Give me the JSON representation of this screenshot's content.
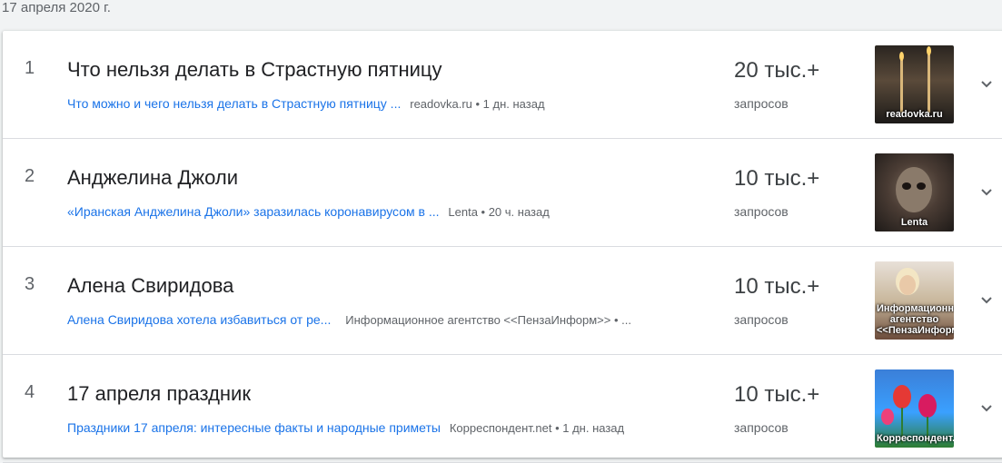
{
  "date_header": "17 апреля 2020 г.",
  "rows": [
    {
      "rank": "1",
      "title": "Что нельзя делать в Страстную пятницу",
      "article_title": "Что можно и чего нельзя делать в Страстную пятницу ...",
      "article_source": "readovka.ru • 1 дн. назад",
      "count": "20 тыс.+",
      "count_label": "запросов",
      "thumb_label": "readovka.ru"
    },
    {
      "rank": "2",
      "title": "Анджелина Джоли",
      "article_title": "«Иранская Анджелина Джоли» заразилась коронавирусом в ...",
      "article_source": "Lenta • 20 ч. назад",
      "count": "10 тыс.+",
      "count_label": "запросов",
      "thumb_label": "Lenta"
    },
    {
      "rank": "3",
      "title": "Алена Свиридова",
      "article_title": "Алена Свиридова хотела избавиться от ре...",
      "article_source": "Информационное агентство <<ПензаИнформ>> • ...",
      "count": "10 тыс.+",
      "count_label": "запросов",
      "thumb_label": "Информационное агентство <<ПензаИнформ>>"
    },
    {
      "rank": "4",
      "title": "17 апреля праздник",
      "article_title": "Праздники 17 апреля: интересные факты и народные приметы",
      "article_source": "Корреспондент.net • 1 дн. назад",
      "count": "10 тыс.+",
      "count_label": "запросов",
      "thumb_label": "Корреспондент.net"
    }
  ],
  "icons": {
    "expand": "chevron-down-icon"
  }
}
